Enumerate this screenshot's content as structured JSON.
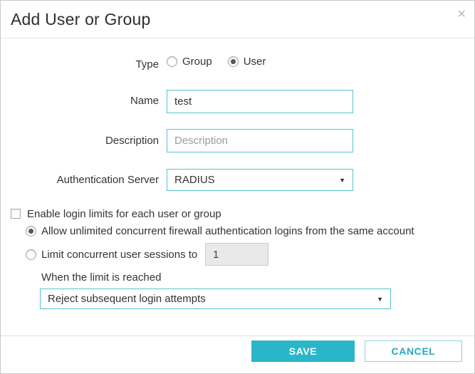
{
  "dialog": {
    "title": "Add User or Group",
    "close_glyph": "×"
  },
  "form": {
    "type": {
      "label": "Type",
      "options": [
        {
          "label": "Group",
          "selected": false
        },
        {
          "label": "User",
          "selected": true
        }
      ]
    },
    "name": {
      "label": "Name",
      "value": "test"
    },
    "description": {
      "label": "Description",
      "placeholder": "Description"
    },
    "auth_server": {
      "label": "Authentication Server",
      "value": "RADIUS",
      "arrow_glyph": "▼"
    }
  },
  "login_limits": {
    "enable": {
      "label": "Enable login limits for each user or group",
      "checked": false
    },
    "allow_unlimited": {
      "label": "Allow unlimited concurrent firewall authentication logins from the same account",
      "selected": true
    },
    "limit_sessions": {
      "label": "Limit concurrent user sessions to",
      "selected": false,
      "value": "1"
    },
    "when_reached": {
      "label": "When the limit is reached"
    },
    "action": {
      "value": "Reject subsequent login attempts",
      "arrow_glyph": "▼"
    }
  },
  "footer": {
    "save_label": "SAVE",
    "cancel_label": "CANCEL"
  },
  "colors": {
    "accent": "#29b6ca",
    "input_border": "#55c3d2",
    "cancel_text": "#2aa9bd"
  }
}
